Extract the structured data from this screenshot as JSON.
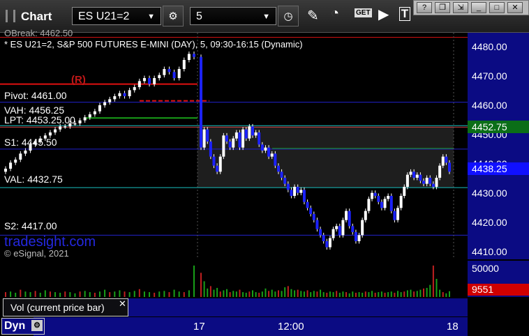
{
  "toolbar": {
    "window_title": "Chart",
    "symbol": "ES U21=2",
    "interval": "5"
  },
  "chart_header": {
    "top_line": "OBreak: 4462.50",
    "description": "* ES U21=2, S&P 500 FUTURES E-MINI (DAY), 5, 09:30-16:15 (Dynamic)",
    "marker_r": "(R)"
  },
  "levels": {
    "pivot": "Pivot: 4461.00",
    "vah": "VAH: 4456.25",
    "lpt": "LPT: 4453.25.00",
    "s1": "S1: 4445.50",
    "val": "VAL: 4432.75",
    "s2": "S2: 4417.00"
  },
  "watermark": {
    "brand": "tradesight.com",
    "copyright": "© eSignal, 2021"
  },
  "price_axis": {
    "ticks": [
      "4480.00",
      "4470.00",
      "4460.00",
      "4450.00",
      "4440.00",
      "4430.00",
      "4420.00",
      "4410.00"
    ],
    "badge_green": "4452.75",
    "badge_blue": "4438.25"
  },
  "volume_axis": {
    "tick": "50000",
    "badge_red": "9551"
  },
  "volume_panel": {
    "label": "Vol (current price bar)"
  },
  "time_axis": {
    "ticks": [
      "17",
      "12:00",
      "18"
    ]
  },
  "status": {
    "dyn_label": "Dyn"
  },
  "chart_data": {
    "type": "candlestick",
    "ylim": [
      4409,
      4484
    ],
    "levels": {
      "pivot": 4461.0,
      "vah": 4456.25,
      "lpt": 4453.25,
      "s1": 4445.5,
      "val": 4432.75,
      "s2": 4417.0,
      "r_line": 4467.0,
      "top_line": 4482.5
    },
    "closes": [
      4439,
      4441,
      4442,
      4444,
      4445,
      4447,
      4448,
      4449,
      4450,
      4451,
      4452,
      4453,
      4453,
      4454,
      4454,
      4455,
      4456,
      4457,
      4458,
      4460,
      4461,
      4462,
      4463,
      4464,
      4463,
      4465,
      4466,
      4468,
      4469,
      4467,
      4469,
      4470,
      4472,
      4471,
      4469,
      4472,
      4475,
      4477,
      4476,
      4446,
      4452,
      4448,
      4443,
      4440,
      4438,
      4443,
      4450,
      4448,
      4446,
      4449,
      4451,
      4446,
      4452,
      4449,
      4453,
      4450,
      4451,
      4447,
      4445,
      4446,
      4443,
      4444,
      4440,
      4438,
      4436,
      4434,
      4432,
      4430,
      4433,
      4431,
      4432,
      4428,
      4426,
      4424,
      4422,
      4419,
      4417,
      4415,
      4413,
      4416,
      4419,
      4420,
      4417,
      4422,
      4425,
      4420,
      4418,
      4415,
      4417,
      4422,
      4425,
      4429,
      4431,
      4430,
      4428,
      4426,
      4429,
      4430,
      4425,
      4422,
      4426,
      4430,
      4433,
      4437,
      4438,
      4436,
      4437,
      4435,
      4434,
      4436,
      4434,
      4433,
      4436,
      4440,
      4443,
      4441,
      4438
    ]
  },
  "volume_data": {
    "ymax": 60000,
    "values": [
      8000,
      9000,
      7000,
      12000,
      9000,
      8000,
      10000,
      7000,
      11000,
      9000,
      8000,
      7000,
      9000,
      8000,
      6000,
      9000,
      10000,
      8000,
      7000,
      9000,
      12000,
      8000,
      9000,
      11000,
      9000,
      8000,
      10000,
      13000,
      9000,
      8000,
      7000,
      9000,
      10000,
      8000,
      12000,
      9000,
      8000,
      11000,
      52000,
      40000,
      26000,
      14000,
      18000,
      12000,
      15000,
      9000,
      11000,
      13000,
      8000,
      10000,
      9000,
      12000,
      8000,
      7000,
      9000,
      11000,
      8000,
      7000,
      9000,
      14000,
      10000,
      12000,
      9000,
      11000,
      10000,
      16000,
      18000,
      13000,
      11000,
      12000,
      10000,
      9000,
      11000,
      8000,
      10000,
      9000,
      12000,
      8000,
      7000,
      9000,
      8000,
      10000,
      7000,
      9000,
      8000,
      6000,
      9000,
      7000,
      8000,
      7000,
      9000,
      8000,
      10000,
      7000,
      8000,
      9000,
      7000,
      8000,
      9000,
      7000,
      10000,
      8000,
      9000,
      11000,
      12000,
      9000,
      10000,
      12000,
      14000,
      15000,
      20000,
      52000,
      30000,
      12000,
      8000,
      6000,
      9551
    ]
  }
}
